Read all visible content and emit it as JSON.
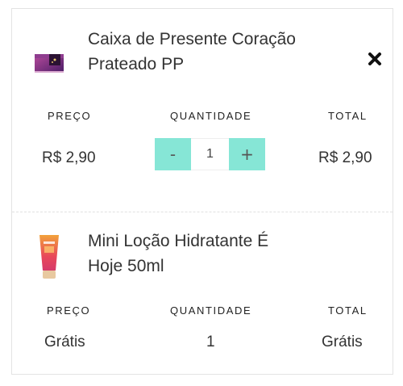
{
  "cart": {
    "items": [
      {
        "name": "Caixa de Presente Coração Prateado PP",
        "name_line1": "Caixa de Presente Coração",
        "name_line2": "Prateado PP",
        "image_icon": "gift-box-thumbnail",
        "price_label": "PREÇO",
        "price": "R$ 2,90",
        "quantity_label": "QUANTIDADE",
        "quantity": "1",
        "decrement_label": "-",
        "increment_label": "+",
        "total_label": "TOTAL",
        "total": "R$ 2,90",
        "remove_icon": "close-icon"
      },
      {
        "name": "Mini Loção Hidratante É Hoje 50ml",
        "name_line1": "Mini Loção Hidratante É",
        "name_line2": "Hoje 50ml",
        "image_icon": "lotion-tube-thumbnail",
        "price_label": "PREÇO",
        "price": "Grátis",
        "quantity_label": "QUANTIDADE",
        "quantity": "1",
        "total_label": "TOTAL",
        "total": "Grátis"
      }
    ]
  },
  "colors": {
    "accent": "#86e6d6",
    "border": "#e3e3e3",
    "text": "#333333"
  }
}
